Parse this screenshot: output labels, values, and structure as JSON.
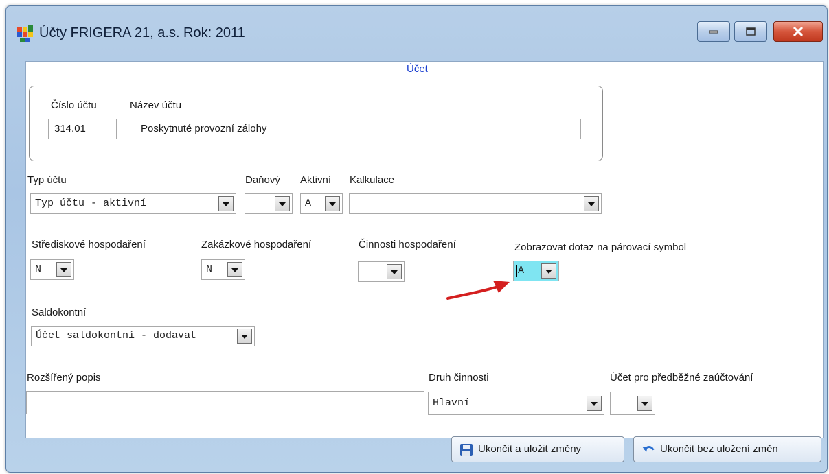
{
  "window": {
    "title": "Účty  FRIGERA 21, a.s.  Rok: 2011",
    "icon": "app-grid-icon"
  },
  "tab_link": "Účet",
  "account": {
    "number_label": "Číslo účtu",
    "number_value": "314.01",
    "name_label": "Název účtu",
    "name_value": "Poskytnuté provozní zálohy"
  },
  "fields": {
    "typ_uctu": {
      "label": "Typ účtu",
      "value": "Typ účtu - aktivní"
    },
    "danovy": {
      "label": "Daňový",
      "value": ""
    },
    "aktivni": {
      "label": "Aktivní",
      "value": "A"
    },
    "kalkulace": {
      "label": "Kalkulace",
      "value": ""
    },
    "strediskove": {
      "label": "Střediskové hospodaření",
      "value": "N"
    },
    "zakazkove": {
      "label": "Zakázkové hospodaření",
      "value": "N"
    },
    "cinnosti": {
      "label": "Činnosti hospodaření",
      "value": ""
    },
    "parovaci": {
      "label": "Zobrazovat dotaz na párovací symbol",
      "value": "A"
    },
    "saldokontni": {
      "label": "Saldokontní",
      "value": "Účet saldokontní - dodavat"
    },
    "rozsireny": {
      "label": "Rozšířený popis",
      "value": ""
    },
    "druh_cinnosti": {
      "label": "Druh činnosti",
      "value": "Hlavní"
    },
    "predbezne": {
      "label": "Účet pro předběžné zaúčtování",
      "value": ""
    }
  },
  "buttons": {
    "save": "Ukončit a uložit změny",
    "cancel": "Ukončit bez uložení změn"
  },
  "colors": {
    "highlight": "#7fe5f2",
    "arrow": "#d41f1f",
    "link": "#1a3fd0"
  }
}
